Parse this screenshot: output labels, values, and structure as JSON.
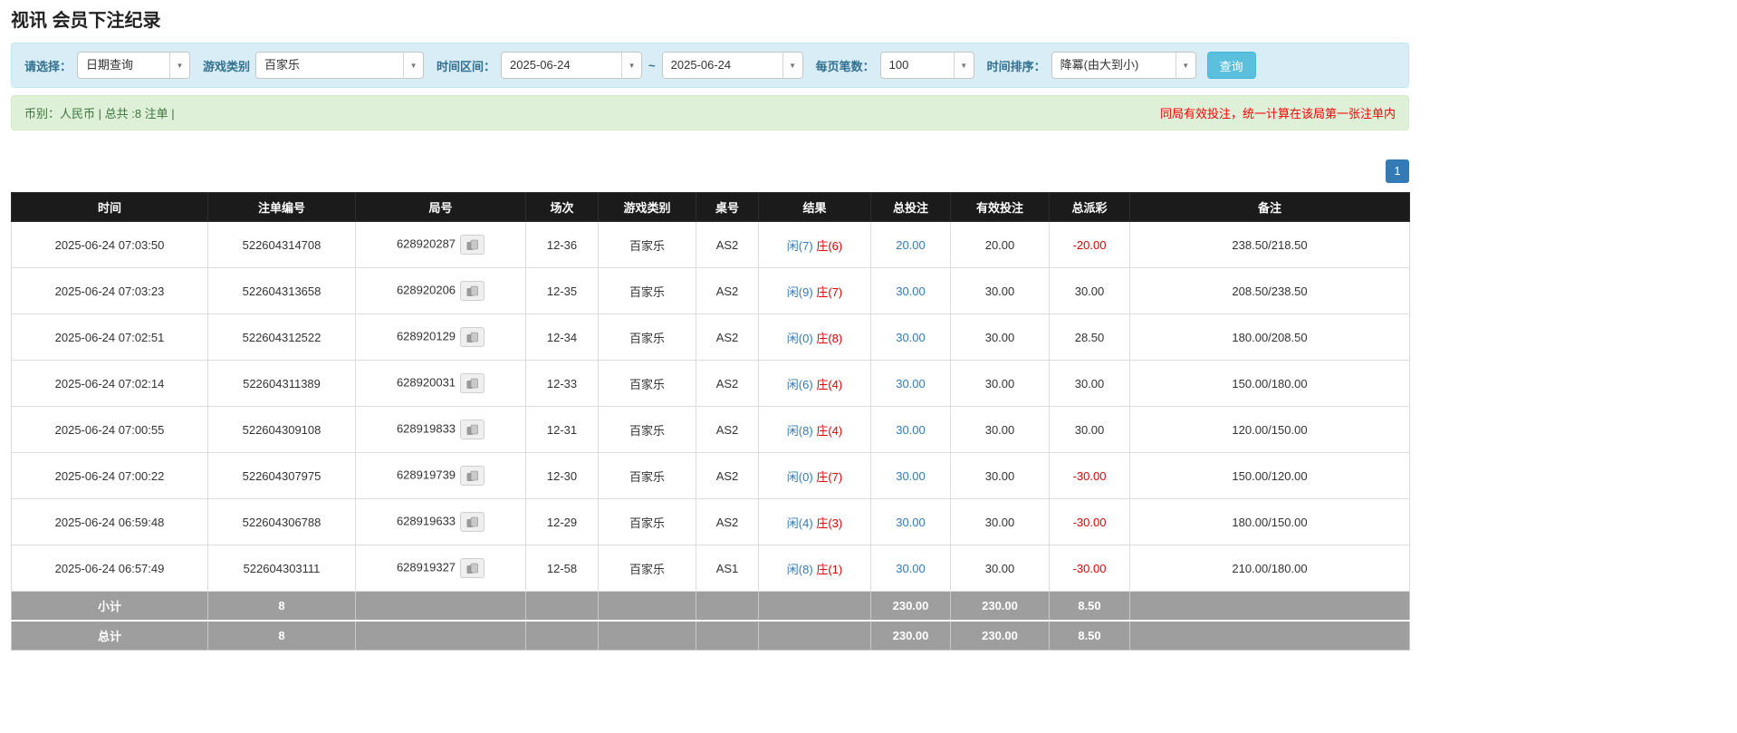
{
  "page_title": "视讯 会员下注纪录",
  "colors": {
    "accent_blue": "#337ab7",
    "filter_bg": "#d9edf7",
    "filter_label": "#31708f",
    "info_bg": "#dff0d8",
    "info_text": "#3c763d",
    "alert_red": "#ff0000",
    "negative_red": "#e60000",
    "header_bg": "#1b1b1b",
    "summary_bg": "#9e9e9e",
    "search_button_bg": "#5bc0de"
  },
  "filters": {
    "select_label": "请选择：",
    "select_value": "日期查询",
    "game_type_label": "游戏类别",
    "game_type_value": "百家乐",
    "time_range_label": "时间区间：",
    "date_from": "2025-06-24",
    "tilde": "~",
    "date_to": "2025-06-24",
    "page_size_label": "每页笔数：",
    "page_size_value": "100",
    "sort_label": "时间排序：",
    "sort_value": "降冪(由大到小)",
    "search_button": "查询"
  },
  "info_bar": {
    "left": "币别：人民币 | 总共 :8 注单 |",
    "right": "同局有效投注，统一计算在该局第一张注单内"
  },
  "pagination": {
    "current": "1"
  },
  "table": {
    "headers": [
      "时间",
      "注单编号",
      "局号",
      "场次",
      "游戏类别",
      "桌号",
      "结果",
      "总投注",
      "有效投注",
      "总派彩",
      "备注"
    ],
    "rows": [
      {
        "time": "2025-06-24 07:03:50",
        "bet_id": "522604314708",
        "round_id": "628920287",
        "session": "12-36",
        "game": "百家乐",
        "table_no": "AS2",
        "result_player": "闲(7)",
        "result_banker": "庄(6)",
        "total_bet": "20.00",
        "valid_bet": "20.00",
        "payout": "-20.00",
        "remark": "238.50/218.50"
      },
      {
        "time": "2025-06-24 07:03:23",
        "bet_id": "522604313658",
        "round_id": "628920206",
        "session": "12-35",
        "game": "百家乐",
        "table_no": "AS2",
        "result_player": "闲(9)",
        "result_banker": "庄(7)",
        "total_bet": "30.00",
        "valid_bet": "30.00",
        "payout": "30.00",
        "remark": "208.50/238.50"
      },
      {
        "time": "2025-06-24 07:02:51",
        "bet_id": "522604312522",
        "round_id": "628920129",
        "session": "12-34",
        "game": "百家乐",
        "table_no": "AS2",
        "result_player": "闲(0)",
        "result_banker": "庄(8)",
        "total_bet": "30.00",
        "valid_bet": "30.00",
        "payout": "28.50",
        "remark": "180.00/208.50"
      },
      {
        "time": "2025-06-24 07:02:14",
        "bet_id": "522604311389",
        "round_id": "628920031",
        "session": "12-33",
        "game": "百家乐",
        "table_no": "AS2",
        "result_player": "闲(6)",
        "result_banker": "庄(4)",
        "total_bet": "30.00",
        "valid_bet": "30.00",
        "payout": "30.00",
        "remark": "150.00/180.00"
      },
      {
        "time": "2025-06-24 07:00:55",
        "bet_id": "522604309108",
        "round_id": "628919833",
        "session": "12-31",
        "game": "百家乐",
        "table_no": "AS2",
        "result_player": "闲(8)",
        "result_banker": "庄(4)",
        "total_bet": "30.00",
        "valid_bet": "30.00",
        "payout": "30.00",
        "remark": "120.00/150.00"
      },
      {
        "time": "2025-06-24 07:00:22",
        "bet_id": "522604307975",
        "round_id": "628919739",
        "session": "12-30",
        "game": "百家乐",
        "table_no": "AS2",
        "result_player": "闲(0)",
        "result_banker": "庄(7)",
        "total_bet": "30.00",
        "valid_bet": "30.00",
        "payout": "-30.00",
        "remark": "150.00/120.00"
      },
      {
        "time": "2025-06-24 06:59:48",
        "bet_id": "522604306788",
        "round_id": "628919633",
        "session": "12-29",
        "game": "百家乐",
        "table_no": "AS2",
        "result_player": "闲(4)",
        "result_banker": "庄(3)",
        "total_bet": "30.00",
        "valid_bet": "30.00",
        "payout": "-30.00",
        "remark": "180.00/150.00"
      },
      {
        "time": "2025-06-24 06:57:49",
        "bet_id": "522604303111",
        "round_id": "628919327",
        "session": "12-58",
        "game": "百家乐",
        "table_no": "AS1",
        "result_player": "闲(8)",
        "result_banker": "庄(1)",
        "total_bet": "30.00",
        "valid_bet": "30.00",
        "payout": "-30.00",
        "remark": "210.00/180.00"
      }
    ],
    "subtotal": {
      "label": "小计",
      "count": "8",
      "total_bet": "230.00",
      "valid_bet": "230.00",
      "payout": "8.50"
    },
    "total": {
      "label": "总计",
      "count": "8",
      "total_bet": "230.00",
      "valid_bet": "230.00",
      "payout": "8.50"
    }
  }
}
